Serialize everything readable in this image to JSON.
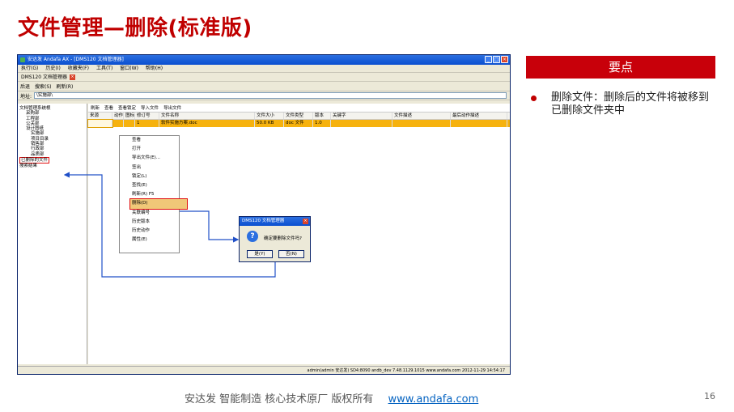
{
  "slide": {
    "title": "文件管理—删除(标准版)",
    "banner": "要点",
    "bullet": "删除文件：删除后的文件将被移到已删除文件夹中",
    "footer_text": "安达发  智能制造 核心技术原厂   版权所有",
    "footer_link": "www.andafa.com",
    "page_number": "16",
    "accent_color": "#c00000"
  },
  "app": {
    "window_title": "安达发 Andafa AX - [DMS120 文档管理器]",
    "menu": [
      "执行(G)",
      "历史(I)",
      "收藏夹(F)",
      "工具(T)",
      "窗口(W)",
      "帮助(H)"
    ],
    "doc_tab": "DMS120 文档管理器",
    "toolbar": [
      "后退",
      "搜索(S)",
      "刷新(R)"
    ],
    "address_label": "地址:",
    "address_value": "\\实施部\\",
    "tree": [
      "文档管理系统根",
      "采购部",
      "工程部",
      "公关部",
      "设计图纸",
      "实施部",
      "项目目录",
      "销售部",
      "行政部",
      "品质部",
      "已删除的文件",
      "搜索结果"
    ],
    "content_toolbar": [
      "刷新",
      "查看",
      "查看锁定",
      "导入文件",
      "导出文件"
    ],
    "columns": [
      "来源",
      "动作",
      "图标",
      "修订号",
      "文件名称",
      "文件大小",
      "文件类型",
      "版本",
      "关键字",
      "文件描述",
      "最后动作描述"
    ],
    "row": {
      "rev": "1",
      "name": "软件实施方案.doc",
      "size": "50.0 KB",
      "type": "doc 文件",
      "version": "1.0"
    },
    "context_menu": [
      "查看",
      "打开",
      "导出文件(E)...",
      "签出",
      "锁定(L)",
      "查找(E)",
      "刷新(R)    F5",
      "删除(D)",
      "关联编号",
      "历史版本",
      "历史动作",
      "属性(E)"
    ],
    "dialog_title": "DMS120 文档管理器",
    "dialog_message": "确定要删除文件吗?",
    "dialog_yes": "是(Y)",
    "dialog_no": "否(N)",
    "status": "admin(admin 安达发)  SD4:8090  andb_dev  7.48.1129.1015  www.andafa.com  2012-11-29 14:54:17"
  }
}
